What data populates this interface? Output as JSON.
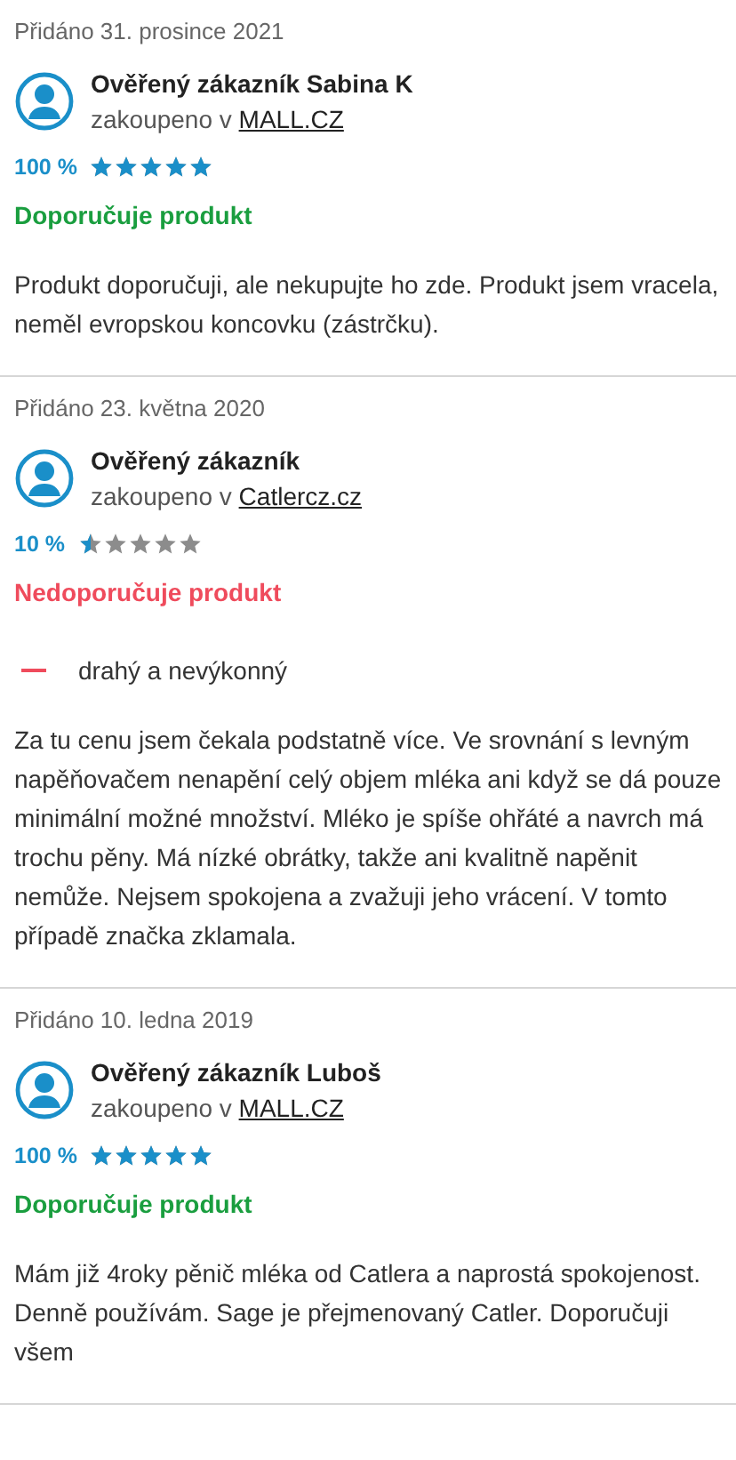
{
  "reviews": [
    {
      "date": "Přidáno 31. prosince 2021",
      "author": "Ověřený zákazník Sabina K",
      "purchased_prefix": "zakoupeno v",
      "shop": "MALL.CZ",
      "percent": "100 %",
      "stars": 5,
      "recommendation": {
        "kind": "positive",
        "text": "Doporučuje produkt"
      },
      "text": "Produkt doporučuji, ale nekupujte ho zde. Produkt jsem vracela, neměl evropskou koncovku (zástrčku)."
    },
    {
      "date": "Přidáno 23. května 2020",
      "author": "Ověřený zákazník",
      "purchased_prefix": "zakoupeno v",
      "shop": "Catlercz.cz",
      "percent": "10 %",
      "stars": 0.5,
      "recommendation": {
        "kind": "negative",
        "text": "Nedoporučuje produkt"
      },
      "cons": [
        "drahý a nevýkonný"
      ],
      "text": "Za tu cenu jsem čekala podstatně více. Ve srovnání s levným napěňovačem nenapění celý objem mléka ani když se dá pouze minimální možné množství. Mléko je spíše ohřáté a navrch má trochu pěny. Má nízké obrátky, takže ani kvalitně napěnit nemůže. Nejsem spokojena a zvažuji jeho vrácení. V tomto případě značka zklamala."
    },
    {
      "date": "Přidáno 10. ledna 2019",
      "author": "Ověřený zákazník Luboš",
      "purchased_prefix": "zakoupeno v",
      "shop": "MALL.CZ",
      "percent": "100 %",
      "stars": 5,
      "recommendation": {
        "kind": "positive",
        "text": "Doporučuje produkt"
      },
      "text": "Mám již 4roky pěnič mléka od Catlera a naprostá spokojenost. Denně používám. Sage je přejmenovaný Catler. Doporučuji všem"
    }
  ]
}
